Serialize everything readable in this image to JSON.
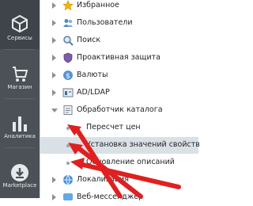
{
  "sidebar": {
    "items": [
      {
        "label": "Сервисы",
        "icon": "cube-icon"
      },
      {
        "label": "Магазин",
        "icon": "cart-icon"
      },
      {
        "label": "Аналитика",
        "icon": "bar-chart-icon"
      },
      {
        "label": "Marketplace",
        "icon": "cloud-download-icon"
      }
    ]
  },
  "tree": {
    "items": [
      {
        "label": "Избранное",
        "icon": "star-icon"
      },
      {
        "label": "Пользователи",
        "icon": "users-icon"
      },
      {
        "label": "Поиск",
        "icon": "search-icon"
      },
      {
        "label": "Проактивная защита",
        "icon": "shield-icon"
      },
      {
        "label": "Валюты",
        "icon": "currency-icon"
      },
      {
        "label": "AD/LDAP",
        "icon": "ldap-icon"
      },
      {
        "label": "Обработчик каталога",
        "icon": "catalog-icon"
      },
      {
        "label": "Пересчет цен"
      },
      {
        "label": "Установка значений свойств"
      },
      {
        "label": "Обновление описаний"
      },
      {
        "label": "Локализация",
        "icon": "globe-icon"
      },
      {
        "label": "Веб-мессенджер",
        "icon": "web-icon"
      }
    ]
  },
  "colors": {
    "sidebar_bg": "#4b5157",
    "selected_row_bg": "#d9e0e6",
    "arrow_red": "#e02020"
  }
}
